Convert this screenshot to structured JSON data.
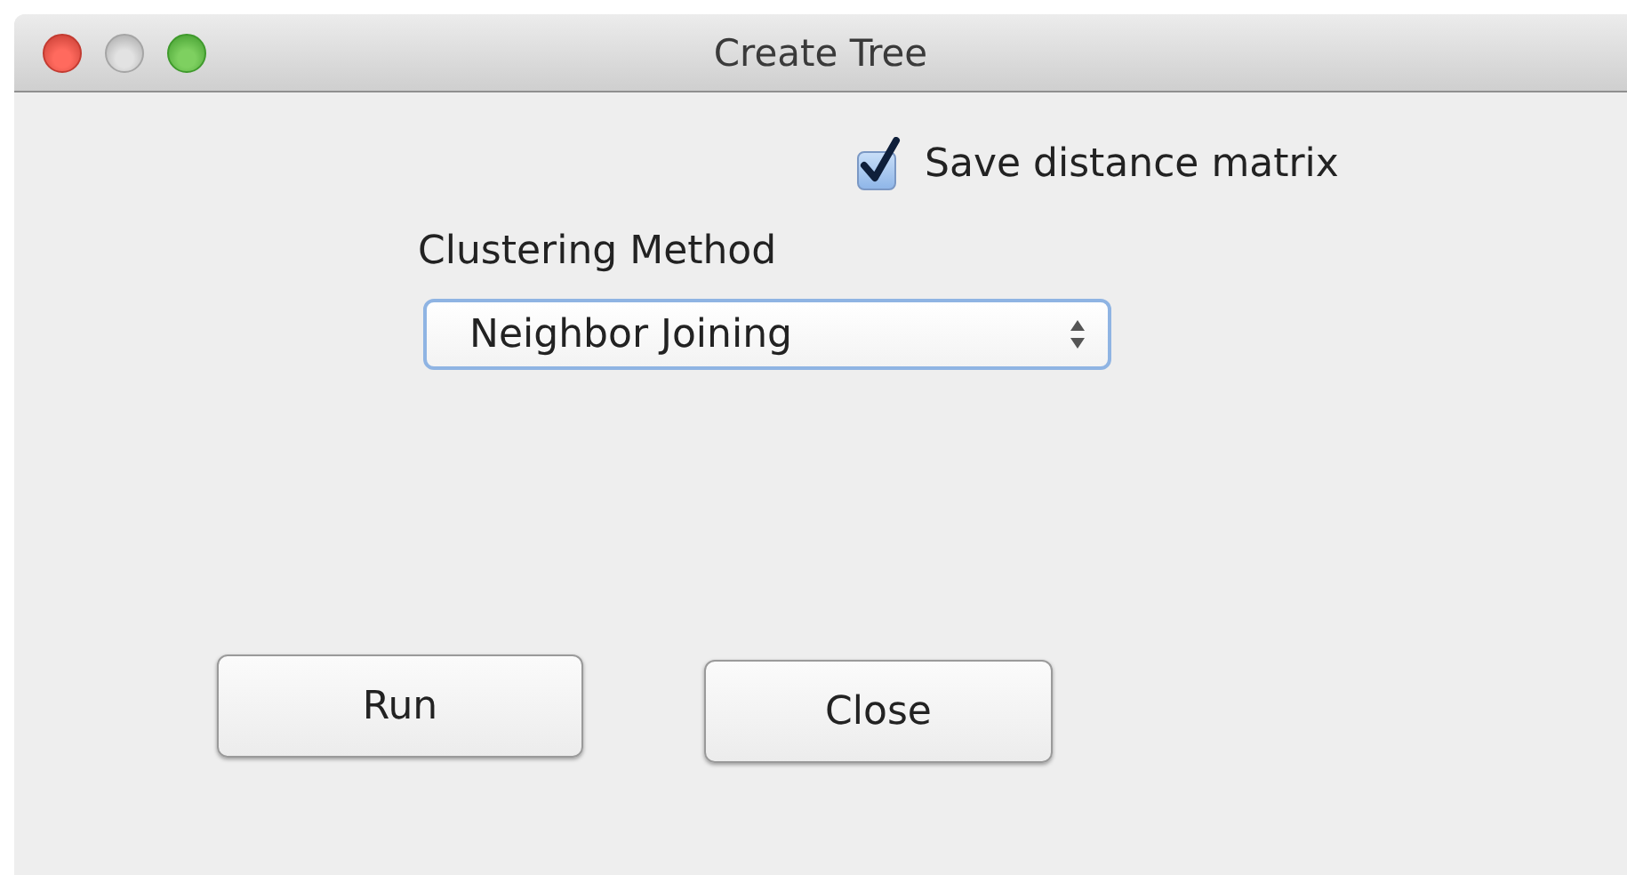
{
  "window": {
    "title": "Create Tree"
  },
  "save_distance_matrix": {
    "label": "Save distance matrix",
    "checked": true
  },
  "clustering_method": {
    "label": "Clustering Method",
    "value": "Neighbor Joining"
  },
  "buttons": [
    {
      "label": "Run"
    },
    {
      "label": "Close"
    }
  ]
}
